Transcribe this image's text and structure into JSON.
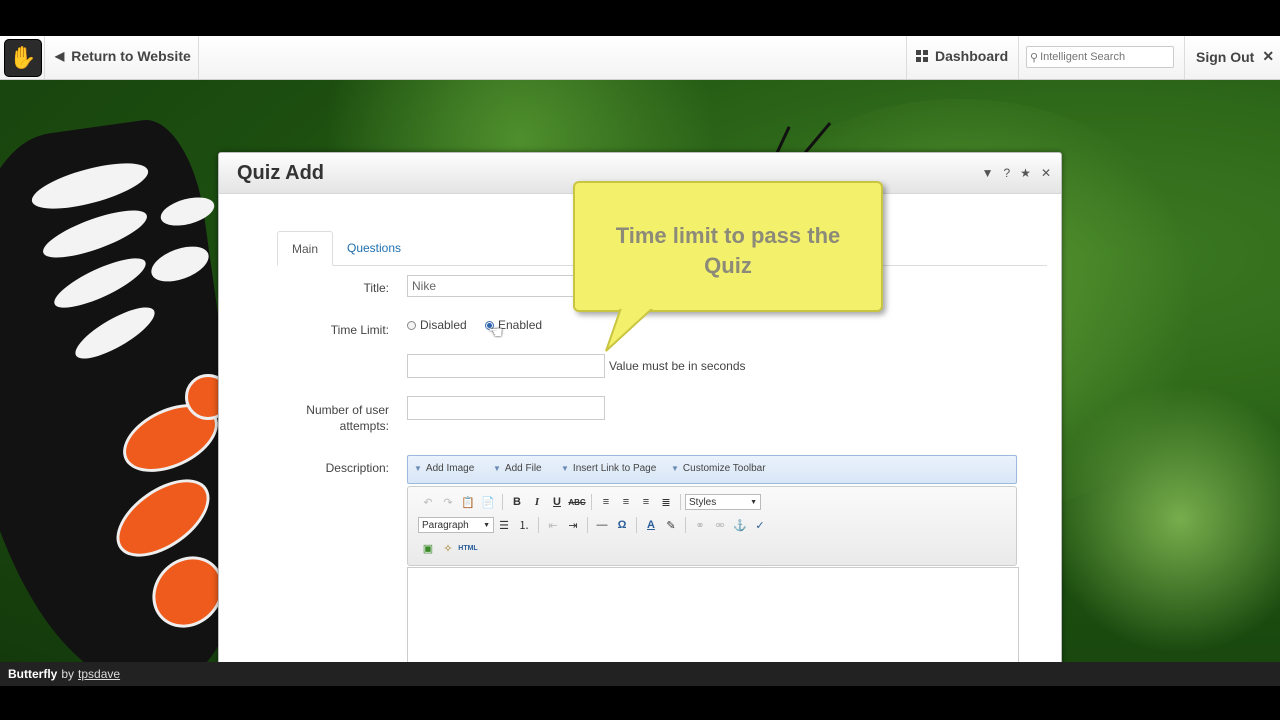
{
  "topbar": {
    "return_label": "Return to Website",
    "dashboard_label": "Dashboard",
    "search_placeholder": "Intelligent Search",
    "signout_label": "Sign Out"
  },
  "dialog": {
    "title": "Quiz Add",
    "controls": [
      "▼",
      "?",
      "★",
      "✕"
    ],
    "tabs": [
      {
        "label": "Main",
        "active": true
      },
      {
        "label": "Questions",
        "active": false
      }
    ],
    "form": {
      "title_label": "Title:",
      "title_value": "Nike",
      "time_limit_label": "Time Limit:",
      "radio_disabled": "Disabled",
      "radio_enabled": "Enabled",
      "selected_option": "Enabled",
      "seconds_hint": "Value must be in seconds",
      "attempts_label_line1": "Number of user",
      "attempts_label_line2": "attempts:",
      "description_label": "Description:"
    },
    "addbar": [
      "Add Image",
      "Add File",
      "Insert Link to Page",
      "Customize Toolbar"
    ],
    "editor": {
      "styles_select": "Styles",
      "format_select": "Paragraph",
      "html_button": "HTML"
    }
  },
  "callout": {
    "line1": "Time limit to pass the",
    "line2": "Quiz"
  },
  "caption": {
    "title": "Butterfly",
    "by": "by",
    "author": "tpsdave"
  },
  "colors": {
    "link": "#1f6fb0",
    "callout_bg": "#f3f06c",
    "addbar_bg": "#d8e6f6"
  }
}
